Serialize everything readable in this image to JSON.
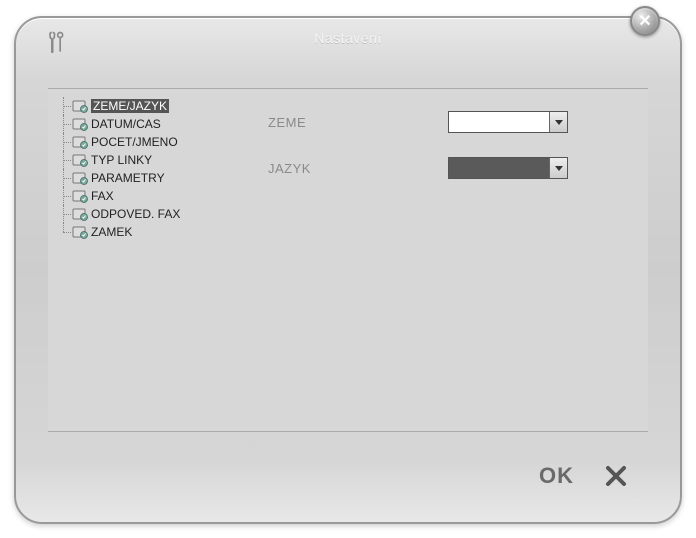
{
  "window": {
    "title": "Nastavení"
  },
  "tree": {
    "items": [
      {
        "label": "ZEME/JAZYK",
        "selected": true
      },
      {
        "label": "DATUM/CAS",
        "selected": false
      },
      {
        "label": "POCET/JMENO",
        "selected": false
      },
      {
        "label": "TYP LINKY",
        "selected": false
      },
      {
        "label": "PARAMETRY",
        "selected": false
      },
      {
        "label": "FAX",
        "selected": false
      },
      {
        "label": "ODPOVED. FAX",
        "selected": false
      },
      {
        "label": "ZAMEK",
        "selected": false
      }
    ]
  },
  "form": {
    "rows": [
      {
        "label": "ZEME",
        "value": "",
        "style": "light"
      },
      {
        "label": "JAZYK",
        "value": "",
        "style": "dark"
      }
    ]
  },
  "buttons": {
    "ok": "OK"
  }
}
